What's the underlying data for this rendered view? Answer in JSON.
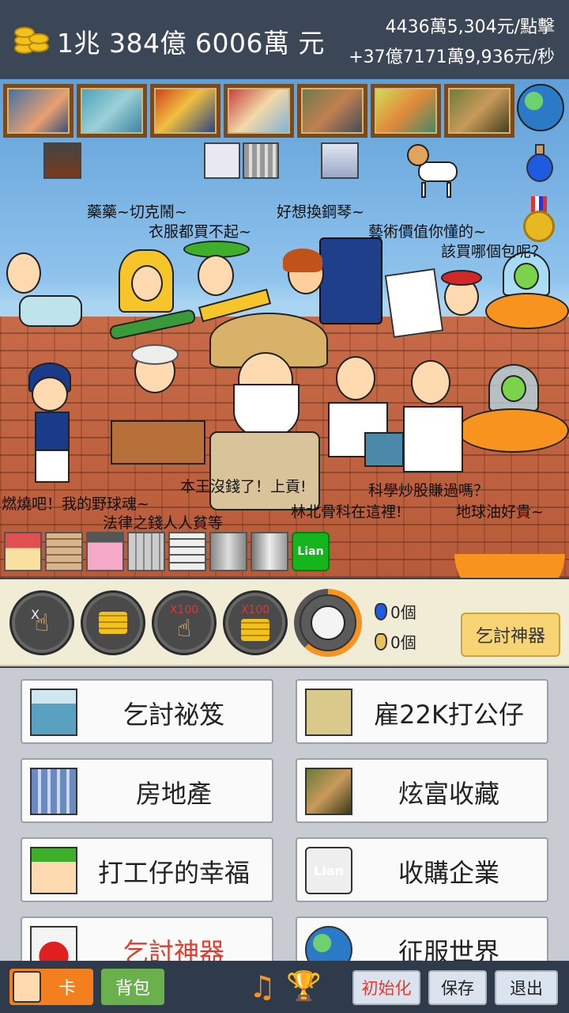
{
  "header": {
    "money": "1兆 384億 6006萬 元",
    "per_click": "4436萬5,304元/點擊",
    "per_second": "+37億7171萬9,936元/秒"
  },
  "scene": {
    "speech": [
      "藥藥~切克鬧~",
      "衣服都買不起~",
      "好想換鋼琴~",
      "藝術價值你懂的~",
      "該買哪個包呢？",
      "燃燒吧！我的野球魂~",
      "法律之錢人人貧等",
      "本王沒錢了！上貢!",
      "科學炒股賺過嗎？",
      "林北骨科在這裡!",
      "地球油好貴~"
    ],
    "business_badge": "Lian"
  },
  "controls": {
    "click_multiplier_label": "X",
    "x100_label": "X100",
    "blue_potion_count": "0個",
    "gold_potion_count": "0個",
    "beg_tool_label": "乞討神器"
  },
  "menu": [
    {
      "label": "乞討祕笈",
      "icon": "bucket-icon"
    },
    {
      "label": "雇22K打公仔",
      "icon": "worker-icon"
    },
    {
      "label": "房地產",
      "icon": "building-icon"
    },
    {
      "label": "炫富收藏",
      "icon": "mona-lisa-icon"
    },
    {
      "label": "打工仔的幸福",
      "icon": "hat-man-icon"
    },
    {
      "label": "收購企業",
      "icon": "lian-icon",
      "icon_text": "Lian"
    },
    {
      "label": "乞討神器",
      "icon": "potion-icon",
      "highlight": "#e23b2e"
    },
    {
      "label": "征服世界",
      "icon": "globe-icon"
    }
  ],
  "bottom": {
    "card_label": "卡",
    "bag_label": "背包",
    "reset_label": "初始化",
    "save_label": "保存",
    "exit_label": "退出"
  }
}
